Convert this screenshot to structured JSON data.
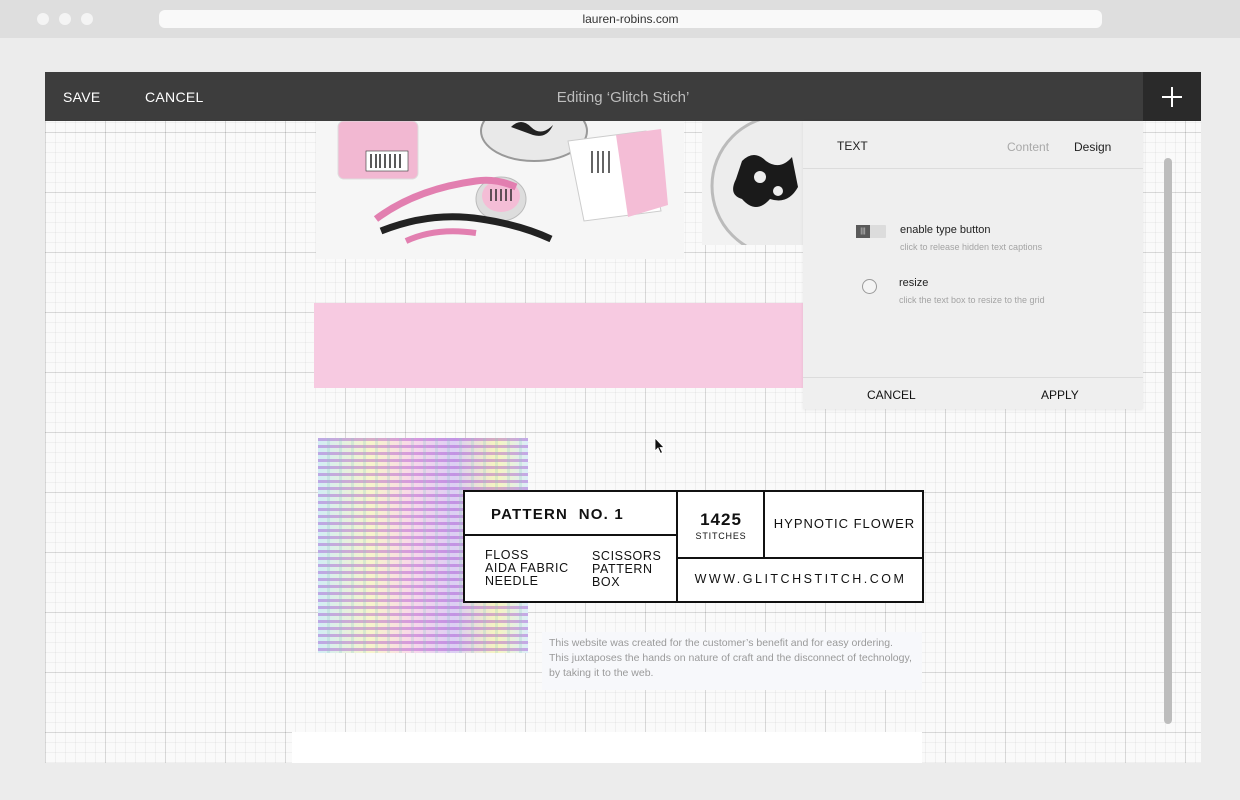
{
  "browser": {
    "url": "lauren-robins.com"
  },
  "toolbar": {
    "save_label": "SAVE",
    "cancel_label": "CANCEL",
    "title": "Editing ‘Glitch Stich’",
    "add_icon": "plus-icon"
  },
  "panel": {
    "type_label": "TEXT",
    "tabs": [
      "Content",
      "Design"
    ],
    "active_tab": "Design",
    "options": [
      {
        "label": "enable type button",
        "hint": "click to release hidden text captions"
      },
      {
        "label": "resize",
        "hint": "click the text box to resize to the grid"
      }
    ],
    "cancel_label": "CANCEL",
    "apply_label": "APPLY"
  },
  "pattern_label": {
    "title": "PATTERN  NO. 1",
    "materials_col1": [
      "FLOSS",
      "AIDA FABRIC",
      "NEEDLE"
    ],
    "materials_col2": [
      "SCISSORS",
      "PATTERN",
      "BOX"
    ],
    "stitch_count": "1425",
    "stitch_unit": "STITCHES",
    "name": "HYPNOTIC FLOWER",
    "website": "WWW.GLITCHSTITCH.COM"
  },
  "caption": "This website was created for the customer’s benefit and for easy ordering. This juxtaposes the hands on nature of craft and the disconnect of technology, by taking it to the web.",
  "colors": {
    "toolbar": "#3d3d3d",
    "accent_pink": "#f7cae1",
    "panel": "#efefef"
  }
}
